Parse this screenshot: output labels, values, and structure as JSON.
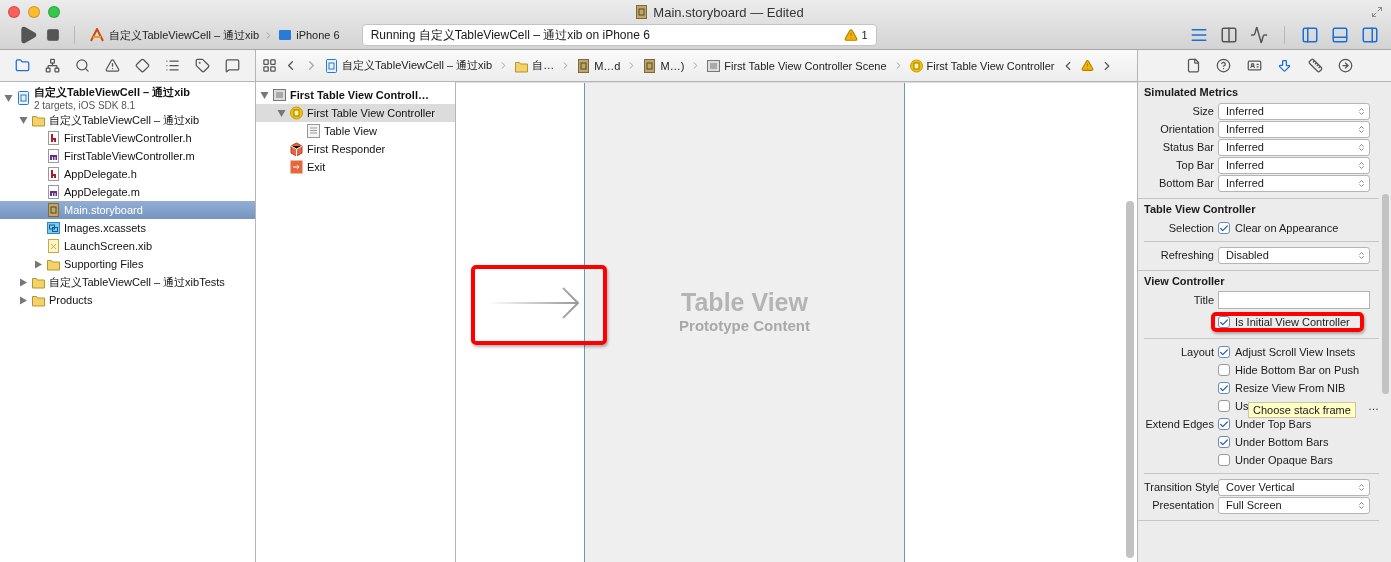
{
  "window": {
    "title": "Main.storyboard — Edited"
  },
  "toolbar": {
    "scheme": "自定义TableViewCell – 通过xib",
    "device": "iPhone 6",
    "status": "Running 自定义TableViewCell – 通过xib on iPhone 6",
    "warnings": "1",
    "editor_modes": [
      {
        "kind": "standard",
        "selected": true
      },
      {
        "kind": "assistant",
        "selected": false
      },
      {
        "kind": "version",
        "selected": false
      }
    ],
    "panels": [
      {
        "kind": "left",
        "on": true
      },
      {
        "kind": "bottom",
        "on": true
      },
      {
        "kind": "right",
        "on": true
      }
    ]
  },
  "navigator": {
    "tabs": [
      {
        "kind": "project",
        "selected": true
      },
      {
        "kind": "symbol",
        "selected": false
      },
      {
        "kind": "find",
        "selected": false
      },
      {
        "kind": "issue",
        "selected": false
      },
      {
        "kind": "test",
        "selected": false
      },
      {
        "kind": "debug",
        "selected": false
      },
      {
        "kind": "breakpoint",
        "selected": false
      },
      {
        "kind": "log",
        "selected": false
      }
    ],
    "tree": [
      {
        "kind": "project",
        "label": "自定义TableViewCell – 通过xib",
        "subtitle": "2 targets, iOS SDK 8.1",
        "expanded": true,
        "selected": false,
        "children": [
          {
            "kind": "folder",
            "label": "自定义TableViewCell – 通过xib",
            "expanded": true,
            "selected": false,
            "children": [
              {
                "kind": "header",
                "label": "FirstTableViewController.h",
                "selected": false
              },
              {
                "kind": "source",
                "label": "FirstTableViewController.m",
                "selected": false
              },
              {
                "kind": "header",
                "label": "AppDelegate.h",
                "selected": false
              },
              {
                "kind": "source",
                "label": "AppDelegate.m",
                "selected": false
              },
              {
                "kind": "storyboard",
                "label": "Main.storyboard",
                "selected": true
              },
              {
                "kind": "assets",
                "label": "Images.xcassets",
                "selected": false
              },
              {
                "kind": "xib",
                "label": "LaunchScreen.xib",
                "selected": false
              },
              {
                "kind": "folder",
                "label": "Supporting Files",
                "expanded": false,
                "selected": false
              }
            ]
          },
          {
            "kind": "folder",
            "label": "自定义TableViewCell – 通过xibTests",
            "expanded": false,
            "selected": false
          },
          {
            "kind": "folder",
            "label": "Products",
            "expanded": false,
            "selected": false
          }
        ]
      }
    ]
  },
  "jump_bar": {
    "crumbs": [
      {
        "kind": "project",
        "label": "自定义TableViewCell – 通过xib"
      },
      {
        "kind": "folder",
        "label": "自…"
      },
      {
        "kind": "storyboard",
        "label": "M…d"
      },
      {
        "kind": "storyboard",
        "label": "M…)"
      },
      {
        "kind": "scene",
        "label": "First Table View Controller Scene"
      },
      {
        "kind": "controller",
        "label": "First Table View Controller"
      }
    ]
  },
  "outline": {
    "tree": [
      {
        "kind": "scene",
        "label": "First Table View Controll…",
        "expanded": true,
        "selected": false,
        "children": [
          {
            "kind": "controller",
            "label": "First Table View Controller",
            "expanded": true,
            "selected": true,
            "children": [
              {
                "kind": "tableview",
                "label": "Table View",
                "selected": false
              }
            ]
          },
          {
            "kind": "responder",
            "label": "First Responder",
            "selected": false
          },
          {
            "kind": "exit",
            "label": "Exit",
            "selected": false
          }
        ]
      }
    ]
  },
  "canvas": {
    "title": "Table View",
    "subtitle": "Prototype Content",
    "entry_arrow": {
      "highlighted": true
    }
  },
  "inspector": {
    "tabs": [
      {
        "kind": "file",
        "selected": false
      },
      {
        "kind": "help",
        "selected": false
      },
      {
        "kind": "identity",
        "selected": false
      },
      {
        "kind": "attributes",
        "selected": true
      },
      {
        "kind": "size",
        "selected": false
      },
      {
        "kind": "connections",
        "selected": false
      }
    ],
    "sections": [
      {
        "title": "Simulated Metrics",
        "rows": [
          {
            "kind": "select",
            "label": "Size",
            "value": "Inferred"
          },
          {
            "kind": "select",
            "label": "Orientation",
            "value": "Inferred"
          },
          {
            "kind": "select",
            "label": "Status Bar",
            "value": "Inferred"
          },
          {
            "kind": "select",
            "label": "Top Bar",
            "value": "Inferred"
          },
          {
            "kind": "select",
            "label": "Bottom Bar",
            "value": "Inferred"
          }
        ]
      },
      {
        "title": "Table View Controller",
        "rows": [
          {
            "kind": "check",
            "label": "Selection",
            "text": "Clear on Appearance",
            "checked": true
          },
          {
            "kind": "divider"
          },
          {
            "kind": "select",
            "label": "Refreshing",
            "value": "Disabled"
          }
        ]
      },
      {
        "title": "View Controller",
        "rows": [
          {
            "kind": "field",
            "label": "Title"
          },
          {
            "kind": "check",
            "text": "Is Initial View Controller",
            "checked": true,
            "highlighted": true
          },
          {
            "kind": "divider"
          },
          {
            "kind": "check",
            "label": "Layout",
            "text": "Adjust Scroll View Insets",
            "checked": true
          },
          {
            "kind": "check",
            "text": "Hide Bottom Bar on Push",
            "checked": false
          },
          {
            "kind": "check",
            "text": "Resize View From NIB",
            "checked": true
          },
          {
            "kind": "check",
            "text": "Us",
            "checked": false,
            "tooltip": "Choose stack frame",
            "tail": "…"
          },
          {
            "kind": "check",
            "label": "Extend Edges",
            "text": "Under Top Bars",
            "checked": true
          },
          {
            "kind": "check",
            "text": "Under Bottom Bars",
            "checked": true
          },
          {
            "kind": "check",
            "text": "Under Opaque Bars",
            "checked": false
          },
          {
            "kind": "divider"
          },
          {
            "kind": "select",
            "label": "Transition Style",
            "value": "Cover Vertical"
          },
          {
            "kind": "select",
            "label": "Presentation",
            "value": "Full Screen"
          }
        ]
      }
    ]
  }
}
